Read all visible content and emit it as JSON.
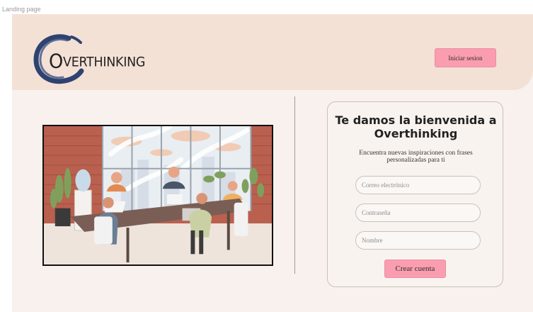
{
  "frame": {
    "label": "Landing page"
  },
  "header": {
    "logo_initial": "O",
    "logo_rest": "VERTHINKING",
    "login_label": "Iniciar sesion"
  },
  "colors": {
    "header_bg": "#f4e1d6",
    "page_bg": "#f8f1ed",
    "accent_button": "#fb9db0",
    "logo_ring": "#2e4370"
  },
  "signup": {
    "title_line1": "Te damos la bienvenida a",
    "title_line2": "Overthinking",
    "subtitle": "Encuentra nuevas inspiraciones con frases personalizadas para ti",
    "email_placeholder": "Correo electrónico",
    "password_placeholder": "Contraseña",
    "name_placeholder": "Nombre",
    "submit_label": "Crear cuenta"
  },
  "illustration": {
    "subject": "team-meeting-illustration"
  }
}
